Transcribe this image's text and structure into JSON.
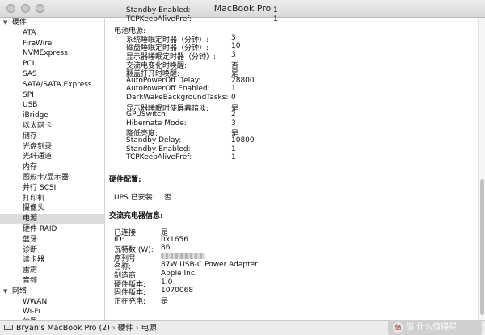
{
  "window": {
    "title": "MacBook Pro"
  },
  "sidebar": {
    "groups": [
      {
        "label": "硬件",
        "expanded": true,
        "items": [
          "ATA",
          "FireWire",
          "NVMExpress",
          "PCI",
          "SAS",
          "SATA/SATA Express",
          "SPI",
          "USB",
          "iBridge",
          "以太网卡",
          "储存",
          "光盘刻录",
          "光纤通道",
          "内存",
          "图形卡/显示器",
          "并行 SCSI",
          "打印机",
          "摄像头",
          "电源",
          "硬件 RAID",
          "蓝牙",
          "诊断",
          "读卡器",
          "雷雳",
          "音频"
        ]
      },
      {
        "label": "网络",
        "expanded": true,
        "items": [
          "WWAN",
          "Wi-Fi",
          "位置"
        ]
      }
    ],
    "selected_item": "电源"
  },
  "details": {
    "ac_tail": [
      {
        "key": "Standby Enabled:",
        "value": "1"
      },
      {
        "key": "TCPKeepAlivePref:",
        "value": "1"
      }
    ],
    "battery_header": "电池电源:",
    "battery": [
      {
        "key": "系统睡眠定时器（分钟）:",
        "value": "3"
      },
      {
        "key": "磁盘睡眠定时器（分钟）:",
        "value": "10"
      },
      {
        "key": "显示器睡眠定时器（分钟）:",
        "value": "3"
      },
      {
        "key": "交流电变化时唤醒:",
        "value": "否"
      },
      {
        "key": "翻盖打开时唤醒:",
        "value": "是"
      },
      {
        "key": "AutoPowerOff Delay:",
        "value": "28800"
      },
      {
        "key": "AutoPowerOff Enabled:",
        "value": "1"
      },
      {
        "key": "DarkWakeBackgroundTasks:",
        "value": "0"
      },
      {
        "key": "显示器睡眠时使屏幕暗淡:",
        "value": "是"
      },
      {
        "key": "GPUSwitch:",
        "value": "2"
      },
      {
        "key": "Hibernate Mode:",
        "value": "3"
      },
      {
        "key": "降低亮度:",
        "value": "是"
      },
      {
        "key": "Standby Delay:",
        "value": "10800"
      },
      {
        "key": "Standby Enabled:",
        "value": "1"
      },
      {
        "key": "TCPKeepAlivePref:",
        "value": "1"
      }
    ],
    "hardware_config_header": "硬件配置:",
    "ups": {
      "key": "UPS 已安装:",
      "value": "否"
    },
    "charger_header": "交流充电器信息:",
    "charger": [
      {
        "key": "已连接:",
        "value": "是"
      },
      {
        "key": "ID:",
        "value": "0x1656"
      },
      {
        "key": "瓦特数 (W):",
        "value": "86"
      },
      {
        "key": "序列号:",
        "value": "",
        "redacted": true
      },
      {
        "key": "名称:",
        "value": "87W USB-C Power Adapter"
      },
      {
        "key": "制造商:",
        "value": "Apple Inc."
      },
      {
        "key": "硬件版本:",
        "value": "1.0"
      },
      {
        "key": "固件版本:",
        "value": "1070068"
      },
      {
        "key": "正在充电:",
        "value": "是"
      }
    ]
  },
  "pathbar": {
    "parts": [
      "Bryan's MacBook Pro (2)",
      "硬件",
      "电源"
    ],
    "separator": "›"
  },
  "watermark": {
    "text": "值 什么值得买",
    "badge": "值"
  }
}
